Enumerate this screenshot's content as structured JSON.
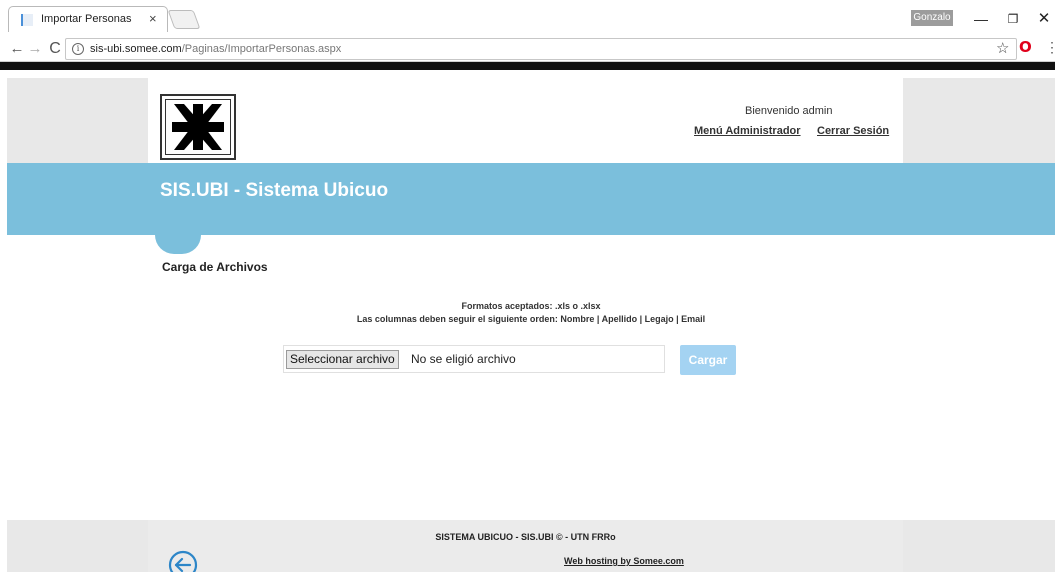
{
  "browser": {
    "tab_title": "Importar Personas",
    "tab_close": "×",
    "profile_name": "Gonzalo",
    "url_host": "sis-ubi.somee.com",
    "url_path": "/Paginas/ImportarPersonas.aspx",
    "window_minimize": "—",
    "window_restore": "❐",
    "window_close": "✕",
    "back_glyph": "←",
    "forward_glyph": "→",
    "reload_glyph": "C",
    "info_glyph": "i",
    "star_glyph": "☆",
    "opera_glyph": "O",
    "menu_glyph": "⋮"
  },
  "header": {
    "welcome": "Bienvenido admin",
    "menu_admin": "Menú Administrador",
    "logout": "Cerrar Sesión"
  },
  "banner": {
    "title": "SIS.UBI - Sistema Ubicuo"
  },
  "main": {
    "section_title": "Carga de Archivos",
    "formats": "Formatos aceptados: .xls o .xlsx",
    "columns": "Las columnas deben seguir el siguiente orden: Nombre | Apellido | Legajo | Email",
    "file_button": "Seleccionar archivo",
    "file_status": "No se eligió archivo",
    "upload_button": "Cargar"
  },
  "footer": {
    "text": "SISTEMA UBICUO - SIS.UBI © - UTN FRRo",
    "hosting": "Web hosting by Somee.com"
  },
  "colors": {
    "banner": "#7bbfdc",
    "upload_button": "#a4d3f2",
    "back_icon": "#2d86c8",
    "opera": "#e0001b"
  }
}
